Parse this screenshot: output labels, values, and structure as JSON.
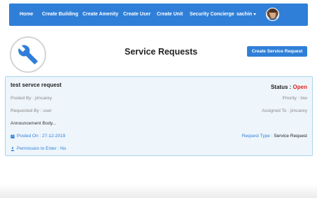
{
  "nav": {
    "items": [
      "Home",
      "Create Building",
      "Create Amenity",
      "Create User",
      "Create Unit",
      "Security Concierge"
    ],
    "user_name": "sachin"
  },
  "header": {
    "title": "Service Requests",
    "create_button": "Create Service Request",
    "logo_icon": "wrench-icon"
  },
  "request": {
    "title": "test servce request",
    "status_label": "Status :",
    "status_value": "Open",
    "posted_by": "Posted By : jimcarey",
    "priority": "Priority : low",
    "requested_by": "Requested By : user",
    "assigned_to": "Assigned To : jimcarey",
    "body": "Announcement Body...",
    "posted_on": "Posted On : 27-12-2019",
    "request_type_label": "Request Type :",
    "request_type_value": "Service Request",
    "permission": "Permission to Enter : No"
  },
  "colors": {
    "primary": "#2f7fd8",
    "status_open": "#e0231d",
    "card_bg": "#eef6fc",
    "card_border": "#a8d4ea"
  }
}
